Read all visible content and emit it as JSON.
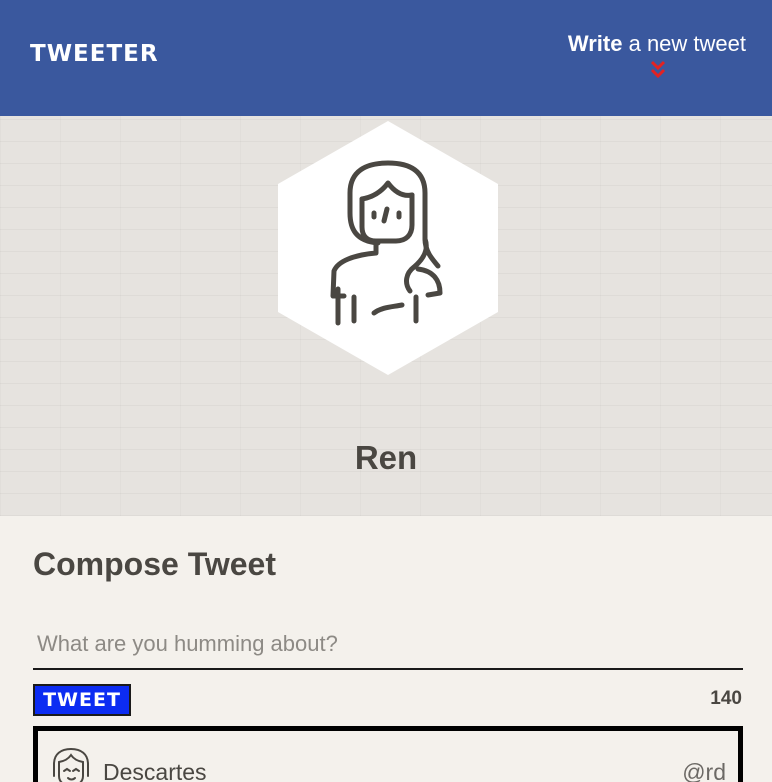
{
  "nav": {
    "logo": "TWEETER",
    "write_bold": "Write",
    "write_rest": " a new tweet",
    "chevron_icon": "double-chevron-down-icon"
  },
  "profile": {
    "name": "Ren",
    "avatar_icon": "girl-avatar-icon"
  },
  "compose": {
    "title": "Compose Tweet",
    "placeholder": "What are you humming about?",
    "button_label": "TWEET",
    "char_count": "140"
  },
  "tweets": [
    {
      "author": "Descartes",
      "handle": "@rd",
      "avatar_icon": "girl-avatar-icon"
    }
  ],
  "colors": {
    "nav_bg": "#3a589e",
    "accent_red": "#e32222",
    "button_blue": "#0c2cf2",
    "page_bg": "#f4f1ec",
    "text": "#4a4742"
  }
}
